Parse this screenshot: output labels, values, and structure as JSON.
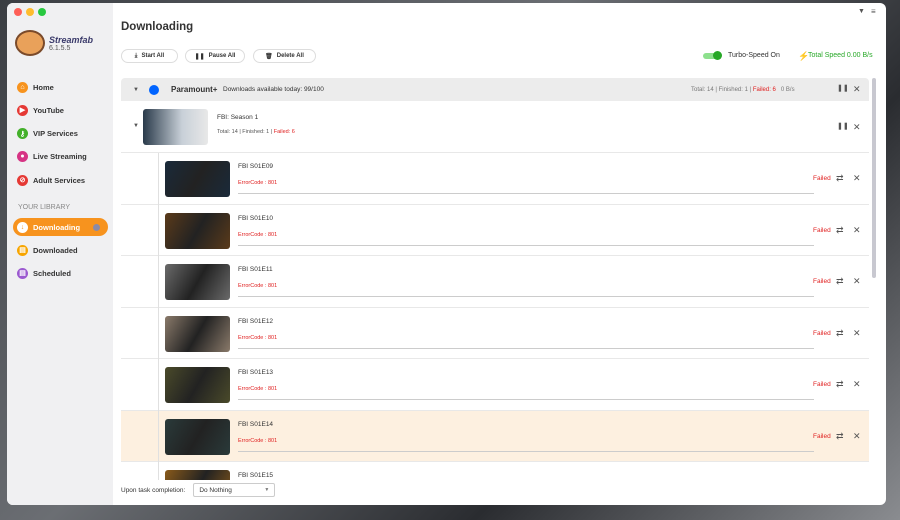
{
  "app": {
    "name": "Streamfab",
    "version": "6.1.5.5"
  },
  "sidebar": {
    "items": [
      {
        "label": "Home",
        "color": "#f7931e"
      },
      {
        "label": "YouTube",
        "color": "#e53935"
      },
      {
        "label": "VIP Services",
        "color": "#43b02a"
      },
      {
        "label": "Live Streaming",
        "color": "#d63384"
      },
      {
        "label": "Adult Services",
        "color": "#e53935"
      }
    ],
    "library_heading": "YOUR LIBRARY",
    "library": [
      {
        "label": "Downloading",
        "color": "#f7931e"
      },
      {
        "label": "Downloaded",
        "color": "#f7a500"
      },
      {
        "label": "Scheduled",
        "color": "#9b59d0"
      }
    ]
  },
  "page_title": "Downloading",
  "toolbar": {
    "start": "Start All",
    "pause": "Pause All",
    "delete": "Delete All",
    "turbo": "Turbo-Speed On",
    "total_speed": "Total Speed 0.00 B/s"
  },
  "group": {
    "service": "Paramount+",
    "available": "Downloads available today: 99/100",
    "total": "Total: 14",
    "finished": "Finished: 1",
    "failed": "Failed: 6",
    "speed": "0 B/s"
  },
  "season": {
    "title": "FBI: Season 1",
    "total": "Total: 14",
    "finished": "Finished: 1",
    "failed": "Failed: 6"
  },
  "episodes": [
    {
      "title": "FBI S01E09",
      "error": "ErrorCode : 801",
      "status": "Failed",
      "color": "#1a2a3a"
    },
    {
      "title": "FBI S01E10",
      "error": "ErrorCode : 801",
      "status": "Failed",
      "color": "#5a3a1a"
    },
    {
      "title": "FBI S01E11",
      "error": "ErrorCode : 801",
      "status": "Failed",
      "color": "#6a6a6a"
    },
    {
      "title": "FBI S01E12",
      "error": "ErrorCode : 801",
      "status": "Failed",
      "color": "#8a7a6a"
    },
    {
      "title": "FBI S01E13",
      "error": "ErrorCode : 801",
      "status": "Failed",
      "color": "#4a4a2a"
    },
    {
      "title": "FBI S01E14",
      "error": "ErrorCode : 801",
      "status": "Failed",
      "color": "#2a3a3a"
    },
    {
      "title": "FBI S01E15",
      "error": "",
      "status": "",
      "color": "#8a5a1a"
    }
  ],
  "footer": {
    "label": "Upon task completion:",
    "option": "Do Nothing"
  }
}
